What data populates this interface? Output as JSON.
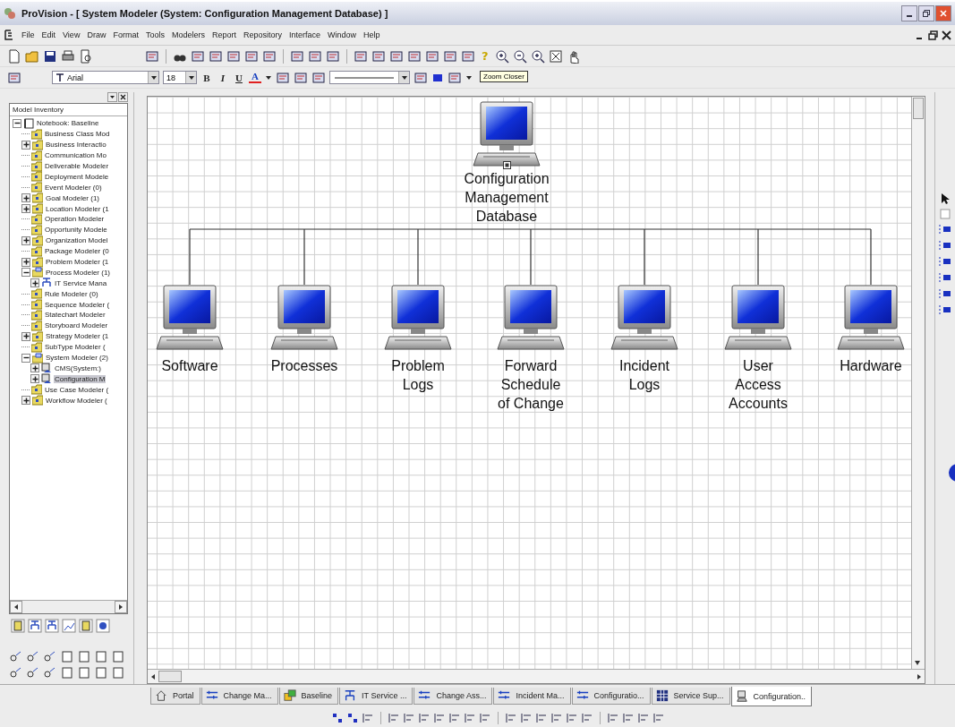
{
  "window": {
    "title": "ProVision - [ System Modeler (System: Configuration Management Database) ]"
  },
  "menu": [
    "File",
    "Edit",
    "View",
    "Draw",
    "Format",
    "Tools",
    "Modelers",
    "Report",
    "Repository",
    "Interface",
    "Window",
    "Help"
  ],
  "format_toolbar": {
    "font": "Arial",
    "size": "18",
    "buttons": [
      {
        "label": "B",
        "kind": "bold"
      },
      {
        "label": "I",
        "kind": "italic"
      },
      {
        "label": "U",
        "kind": "underline"
      },
      {
        "label": "A",
        "kind": "color"
      }
    ]
  },
  "help_glyph": "?",
  "tooltip": "Zoom Closer",
  "inventory": {
    "title": "Model Inventory",
    "tree": [
      {
        "label": "Notebook: Baseline",
        "kind": "notebook",
        "expandable": true,
        "expanded": true,
        "selected": false,
        "children": [
          {
            "label": "Business Class Mod",
            "kind": "folder",
            "expandable": false,
            "selected": false
          },
          {
            "label": "Business Interactio",
            "kind": "folder",
            "expandable": true,
            "expanded": false,
            "selected": false
          },
          {
            "label": "Communication Mo",
            "kind": "folder",
            "expandable": false,
            "selected": false
          },
          {
            "label": "Deliverable Modeler",
            "kind": "folder",
            "expandable": false,
            "selected": false
          },
          {
            "label": "Deployment Modele",
            "kind": "folder",
            "expandable": false,
            "selected": false
          },
          {
            "label": "Event Modeler (0)",
            "kind": "folder",
            "expandable": false,
            "selected": false
          },
          {
            "label": "Goal Modeler (1)",
            "kind": "folder",
            "expandable": true,
            "expanded": false,
            "selected": false
          },
          {
            "label": "Location Modeler (1",
            "kind": "folder",
            "expandable": true,
            "expanded": false,
            "selected": false
          },
          {
            "label": "Operation Modeler",
            "kind": "folder",
            "expandable": false,
            "selected": false
          },
          {
            "label": "Opportunity Modele",
            "kind": "folder",
            "expandable": false,
            "selected": false
          },
          {
            "label": "Organization Model",
            "kind": "folder",
            "expandable": true,
            "expanded": false,
            "selected": false
          },
          {
            "label": "Package Modeler (0",
            "kind": "folder",
            "expandable": false,
            "selected": false
          },
          {
            "label": "Problem Modeler (1",
            "kind": "folder",
            "expandable": true,
            "expanded": false,
            "selected": false
          },
          {
            "label": "Process Modeler (1)",
            "kind": "process",
            "expandable": true,
            "expanded": true,
            "selected": false,
            "children": [
              {
                "label": "IT Service Mana",
                "kind": "hierarchy",
                "expandable": true,
                "expanded": false,
                "selected": false
              }
            ]
          },
          {
            "label": "Rule Modeler (0)",
            "kind": "folder",
            "expandable": false,
            "selected": false
          },
          {
            "label": "Sequence Modeler (",
            "kind": "folder",
            "expandable": false,
            "selected": false
          },
          {
            "label": "Statechart Modeler",
            "kind": "folder",
            "expandable": false,
            "selected": false
          },
          {
            "label": "Storyboard Modeler",
            "kind": "folder",
            "expandable": false,
            "selected": false
          },
          {
            "label": "Strategy Modeler (1",
            "kind": "folder",
            "expandable": true,
            "expanded": false,
            "selected": false
          },
          {
            "label": "SubType Modeler (",
            "kind": "folder",
            "expandable": false,
            "selected": false
          },
          {
            "label": "System Modeler (2)",
            "kind": "process",
            "expandable": true,
            "expanded": true,
            "selected": false,
            "children": [
              {
                "label": "CMS(System:)",
                "kind": "system",
                "expandable": true,
                "expanded": false,
                "selected": false
              },
              {
                "label": "Configuration M",
                "kind": "system",
                "expandable": true,
                "expanded": false,
                "selected": true
              }
            ]
          },
          {
            "label": "Use Case Modeler (",
            "kind": "folder",
            "expandable": false,
            "selected": false
          },
          {
            "label": "Workflow Modeler (",
            "kind": "folder",
            "expandable": true,
            "expanded": false,
            "selected": false
          }
        ]
      }
    ]
  },
  "diagram": {
    "root": {
      "label_lines": [
        "Configuration",
        "Management",
        "Database"
      ]
    },
    "children": [
      {
        "label_lines": [
          "Software"
        ]
      },
      {
        "label_lines": [
          "Processes"
        ]
      },
      {
        "label_lines": [
          "Problem",
          "Logs"
        ]
      },
      {
        "label_lines": [
          "Forward",
          "Schedule",
          "of Change"
        ]
      },
      {
        "label_lines": [
          "Incident",
          "Logs"
        ]
      },
      {
        "label_lines": [
          "User",
          "Access",
          "Accounts"
        ]
      },
      {
        "label_lines": [
          "Hardware"
        ]
      }
    ]
  },
  "document_tabs": [
    {
      "label": "Portal",
      "kind": "home",
      "selected": false
    },
    {
      "label": "Change Ma...",
      "kind": "process",
      "selected": false
    },
    {
      "label": "Baseline",
      "kind": "baseline",
      "selected": false
    },
    {
      "label": "IT Service ...",
      "kind": "hierarchy",
      "selected": false
    },
    {
      "label": "Change Ass...",
      "kind": "process",
      "selected": false
    },
    {
      "label": "Incident Ma...",
      "kind": "process",
      "selected": false
    },
    {
      "label": "Configuratio...",
      "kind": "process",
      "selected": false
    },
    {
      "label": "Service Sup...",
      "kind": "grid",
      "selected": false
    },
    {
      "label": "Configuration..",
      "kind": "system",
      "selected": true
    }
  ]
}
